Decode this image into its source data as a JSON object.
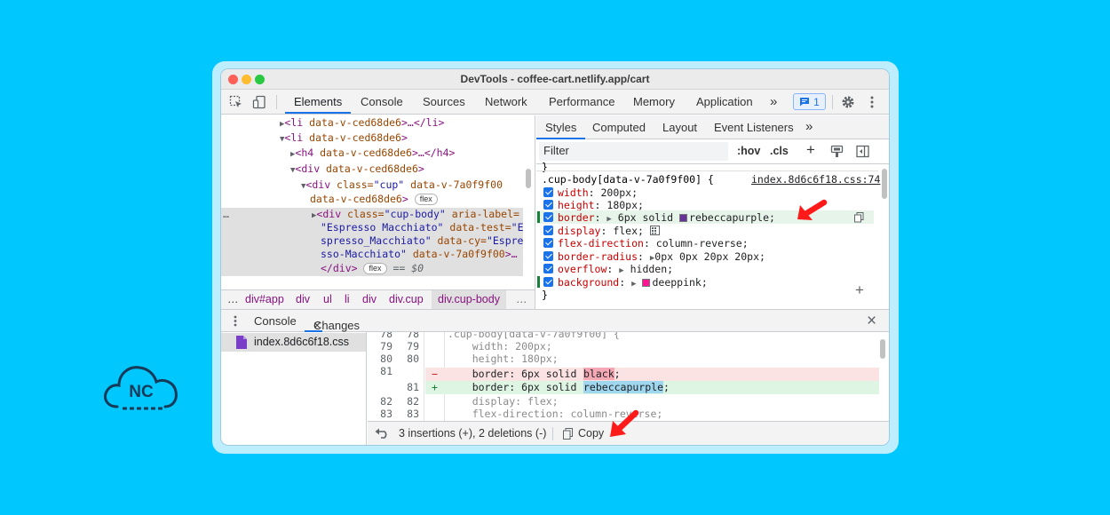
{
  "window": {
    "title": "DevTools - coffee-cart.netlify.app/cart"
  },
  "toolbar": {
    "tabs": [
      "Elements",
      "Console",
      "Sources",
      "Network",
      "Performance",
      "Memory",
      "Application"
    ],
    "more": "»",
    "issues_count": "1"
  },
  "elements": {
    "lines": [
      {
        "open": "<li",
        "attrs": " data-v-ced68de6",
        "close": ">…</li>"
      },
      {
        "open": "<li",
        "attrs": " data-v-ced68de6",
        "close": ">"
      },
      {
        "open": "<h4",
        "attrs": " data-v-ced68de6",
        "close": ">…</h4>"
      },
      {
        "open": "<div",
        "attrs": " data-v-ced68de6",
        "close": ">"
      }
    ],
    "cup_div": {
      "tag": "<div",
      "class_attr": " class=",
      "class_val": "\"cup\"",
      "attr1": " data-v-7a0f9f00",
      "attr2": "data-v-ced68de6",
      "close": ">"
    },
    "cup_body": {
      "tag": "<div",
      "class_attr": " class=",
      "class_val": "\"cup-body\"",
      "aria_attr": " aria-label=",
      "aria_val": "\"Espresso Macchiato\"",
      "test_attr": " data-test=",
      "test_val1": "\"E",
      "test_val2": "spresso_Macchiato\"",
      "cy_attr": " data-cy=",
      "cy_val1": "\"Espre",
      "cy_val2": "sso-Macchiato\"",
      "attr_end": " data-v-7a0f9f00",
      "close": ">…"
    },
    "end_div": "</div>",
    "flex_badge": "flex",
    "eq": "== $0",
    "dots": "…"
  },
  "breadcrumb": [
    "…",
    "div#app",
    "div",
    "ul",
    "li",
    "div",
    "div.cup",
    "div.cup-body",
    "…"
  ],
  "styles": {
    "tabs": [
      "Styles",
      "Computed",
      "Layout",
      "Event Listeners",
      "»"
    ],
    "filter_placeholder": "Filter",
    "hov": ":hov",
    "cls": ".cls",
    "plus": "+",
    "selector": ".cup-body[data-v-7a0f9f00] {",
    "source": "index.8d6c6f18.css:74",
    "prev_brace": "}",
    "props": [
      {
        "name": "width",
        "value": "200px;"
      },
      {
        "name": "height",
        "value": "180px;"
      },
      {
        "name": "border",
        "pre": "6px solid ",
        "value": "rebeccapurple;",
        "swatch": "#663399"
      },
      {
        "name": "display",
        "value": "flex;"
      },
      {
        "name": "flex-direction",
        "value": "column-reverse;"
      },
      {
        "name": "border-radius",
        "value": "0px 0px 20px 20px;"
      },
      {
        "name": "overflow",
        "value": "hidden;"
      },
      {
        "name": "background",
        "value": "deeppink;",
        "swatch": "#ff1493"
      }
    ],
    "closing_brace": "}"
  },
  "drawer": {
    "tabs": [
      "Console",
      "Changes"
    ],
    "close_x": "×"
  },
  "changes": {
    "file": "index.8d6c6f18.css",
    "diff": [
      {
        "a": "78",
        "b": "78",
        "mark": "",
        "type": "ctx",
        "text": ".cup-body[data-v-7a0f9f00] {"
      },
      {
        "a": "79",
        "b": "79",
        "mark": "",
        "type": "ctx",
        "text": "    width: 200px;"
      },
      {
        "a": "80",
        "b": "80",
        "mark": "",
        "type": "ctx",
        "text": "    height: 180px;"
      },
      {
        "a": "81",
        "b": "",
        "mark": "−",
        "type": "del",
        "pre": "    border: 6px solid ",
        "hl": "black",
        "post": ";"
      },
      {
        "a": "",
        "b": "81",
        "mark": "+",
        "type": "add",
        "pre": "    border: 6px solid ",
        "hl": "rebeccapurple",
        "post": ";"
      },
      {
        "a": "82",
        "b": "82",
        "mark": "",
        "type": "ctx",
        "text": "    display: flex;"
      },
      {
        "a": "83",
        "b": "83",
        "mark": "",
        "type": "ctx",
        "text": "    flex-direction: column-reverse;"
      }
    ],
    "summary": "3 insertions (+), 2 deletions (-)",
    "copy": "Copy"
  },
  "logo": {
    "text": "NC"
  },
  "colors": {
    "background": "#00c8ff",
    "accent": "#1a73e8",
    "arrow": "#ff1a1a",
    "rebeccapurple": "#663399",
    "deeppink": "#ff1493"
  }
}
